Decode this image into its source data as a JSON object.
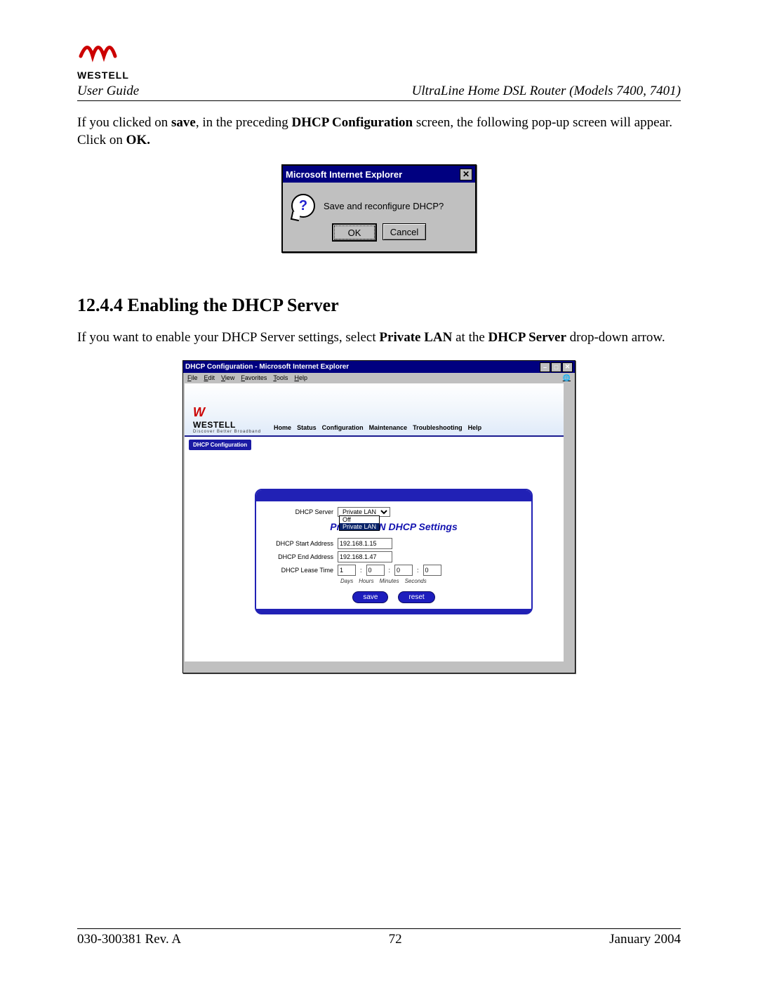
{
  "header": {
    "brand": "WESTELL",
    "left": "User Guide",
    "right": "UltraLine Home DSL Router (Models 7400, 7401)"
  },
  "para1": {
    "pre": "If you clicked on ",
    "save": "save",
    "mid": ", in the preceding ",
    "dhcp": "DHCP Configuration",
    "post1": " screen, the following pop-up screen will appear. Click on ",
    "ok": "OK.",
    "tail": ""
  },
  "popup": {
    "title": "Microsoft Internet Explorer",
    "message": "Save and reconfigure DHCP?",
    "ok": "OK",
    "cancel": "Cancel"
  },
  "section_heading": "12.4.4  Enabling the DHCP Server",
  "para2": {
    "pre": "If you want to enable your DHCP Server settings, select ",
    "pl": "Private LAN",
    "mid": " at the ",
    "ds": "DHCP Server",
    "post": " drop-down arrow."
  },
  "ie": {
    "title": "DHCP Configuration - Microsoft Internet Explorer",
    "menus": [
      "File",
      "Edit",
      "View",
      "Favorites",
      "Tools",
      "Help"
    ],
    "nav": [
      "Home",
      "Status",
      "Configuration",
      "Maintenance",
      "Troubleshooting",
      "Help"
    ],
    "brand_name": "WESTELL",
    "brand_tag": "Discover Better Broadband",
    "sidebar_chip": "DHCP Configuration",
    "labels": {
      "dhcp_server": "DHCP Server",
      "start": "DHCP Start Address",
      "end": "DHCP End Address",
      "lease": "DHCP Lease Time"
    },
    "values": {
      "dhcp_server": "Private LAN",
      "start": "192.168.1.15",
      "end": "192.168.1.47",
      "days": "1",
      "hours": "0",
      "minutes": "0",
      "seconds": "0"
    },
    "dropdown": {
      "off": "Off",
      "private": "Private LAN"
    },
    "settings_title": "Private LAN DHCP Settings",
    "time_units": [
      "Days",
      "Hours",
      "Minutes",
      "Seconds"
    ],
    "buttons": {
      "save": "save",
      "reset": "reset"
    }
  },
  "footer": {
    "left": "030-300381 Rev. A",
    "center": "72",
    "right": "January 2004"
  }
}
